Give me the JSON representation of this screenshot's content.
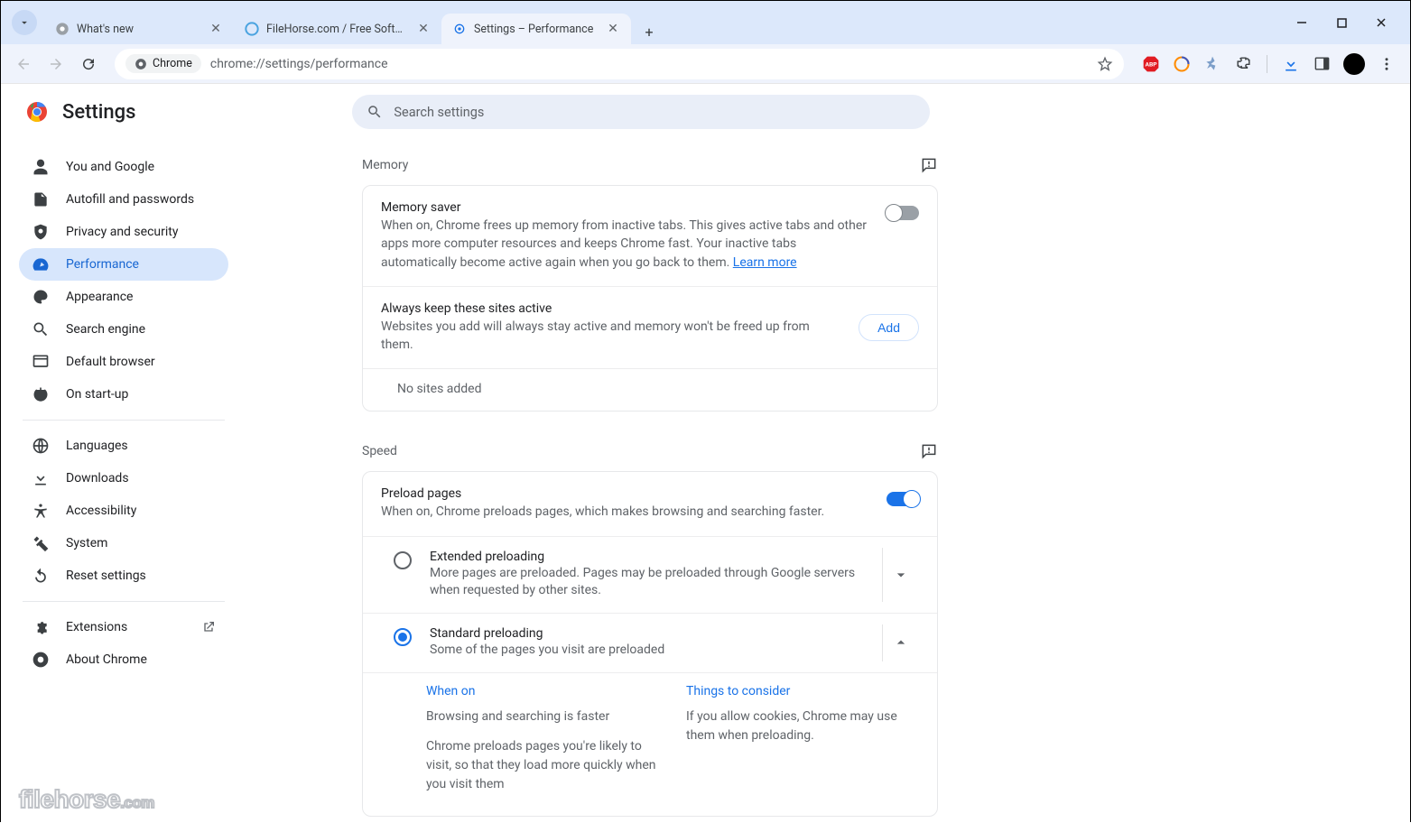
{
  "window": {
    "min": "—",
    "max": "☐",
    "close": "✕"
  },
  "tabs": [
    {
      "title": "What's new",
      "active": false
    },
    {
      "title": "FileHorse.com / Free Software",
      "active": false
    },
    {
      "title": "Settings – Performance",
      "active": true
    }
  ],
  "toolbar": {
    "chip": "Chrome",
    "url": "chrome://settings/performance"
  },
  "header": {
    "title": "Settings",
    "search_placeholder": "Search settings"
  },
  "sidebar": {
    "groups": [
      [
        "You and Google",
        "Autofill and passwords",
        "Privacy and security",
        "Performance",
        "Appearance",
        "Search engine",
        "Default browser",
        "On start-up"
      ],
      [
        "Languages",
        "Downloads",
        "Accessibility",
        "System",
        "Reset settings"
      ],
      [
        "Extensions",
        "About Chrome"
      ]
    ],
    "active": "Performance",
    "external": [
      "Extensions"
    ]
  },
  "memory": {
    "section": "Memory",
    "saver_title": "Memory saver",
    "saver_desc": "When on, Chrome frees up memory from inactive tabs. This gives active tabs and other apps more computer resources and keeps Chrome fast. Your inactive tabs automatically become active again when you go back to them. ",
    "learn_more": "Learn more",
    "saver_on": false,
    "keep_title": "Always keep these sites active",
    "keep_desc": "Websites you add will always stay active and memory won't be freed up from them.",
    "add_label": "Add",
    "empty": "No sites added"
  },
  "speed": {
    "section": "Speed",
    "preload_title": "Preload pages",
    "preload_desc": "When on, Chrome preloads pages, which makes browsing and searching faster.",
    "preload_on": true,
    "options": [
      {
        "title": "Extended preloading",
        "desc": "More pages are preloaded. Pages may be preloaded through Google servers when requested by other sites.",
        "checked": false,
        "expanded": false
      },
      {
        "title": "Standard preloading",
        "desc": "Some of the pages you visit are preloaded",
        "checked": true,
        "expanded": true
      }
    ],
    "details": {
      "left_h": "When on",
      "left_p1": "Browsing and searching is faster",
      "left_p2": "Chrome preloads pages you're likely to visit, so that they load more quickly when you visit them",
      "right_h": "Things to consider",
      "right_p1": "If you allow cookies, Chrome may use them when preloading."
    }
  },
  "watermark": {
    "name": "filehorse",
    "tld": ".com"
  }
}
